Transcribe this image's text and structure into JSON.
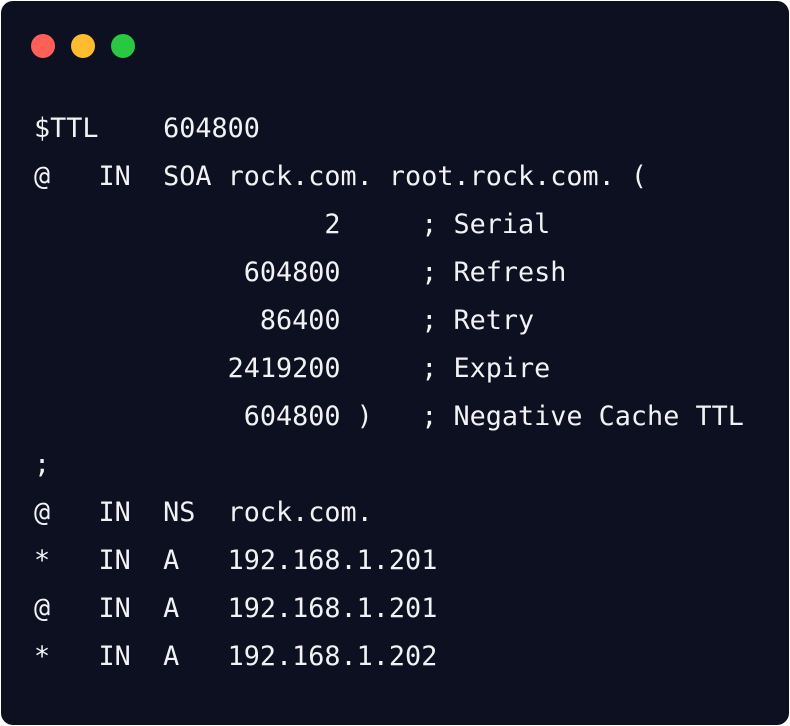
{
  "window": {
    "background": "#0d1020",
    "text_color": "#f2f2f4",
    "controls": [
      {
        "name": "close",
        "color": "#ff5f57"
      },
      {
        "name": "minimize",
        "color": "#febc2e"
      },
      {
        "name": "maximize",
        "color": "#28c840"
      }
    ]
  },
  "code": {
    "lines": [
      "$TTL    604800",
      "@   IN  SOA rock.com. root.rock.com. (",
      "                  2     ; Serial",
      "             604800     ; Refresh",
      "              86400     ; Retry",
      "            2419200     ; Expire",
      "             604800 )   ; Negative Cache TTL",
      ";",
      "@   IN  NS  rock.com.",
      "*   IN  A   192.168.1.201",
      "@   IN  A   192.168.1.201",
      "*   IN  A   192.168.1.202"
    ]
  }
}
